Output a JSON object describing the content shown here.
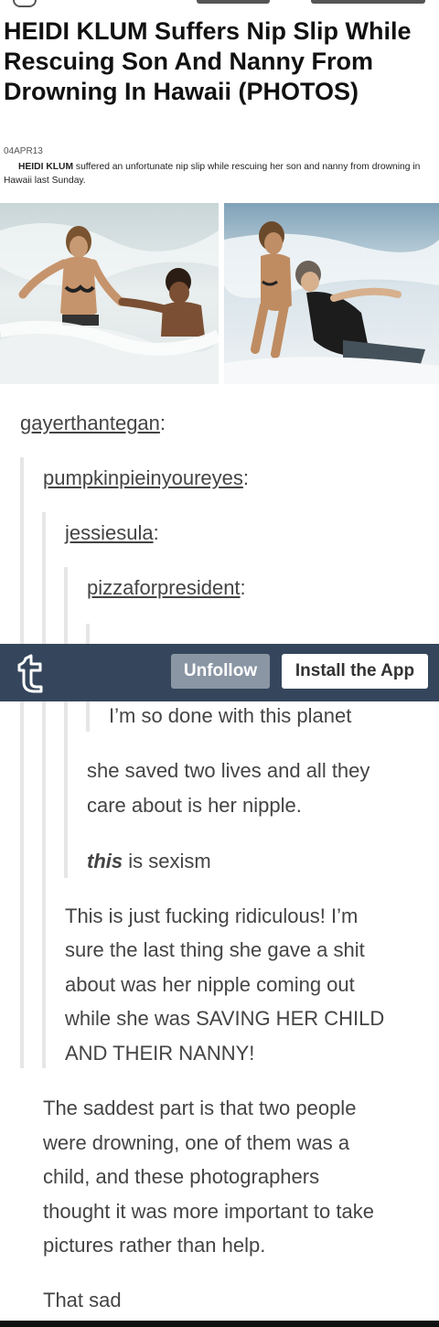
{
  "article": {
    "headline": "HEIDI KLUM Suffers Nip Slip While Rescuing Son And Nanny From Drowning In Hawaii (PHOTOS)",
    "date": "04APR13",
    "summary_bold": "HEIDI KLUM",
    "summary_rest": " suffered an unfortunate nip slip while rescuing her son and nanny from drowning in Hawaii last Sunday."
  },
  "reblog_chain": [
    {
      "username": "gayerthantegan",
      "colon": ":"
    },
    {
      "username": "pumpkinpieinyoureyes",
      "colon": ":"
    },
    {
      "username": "jessiesula",
      "colon": ":"
    },
    {
      "username": "pizzaforpresident",
      "colon": ":"
    }
  ],
  "tumblr_bar": {
    "logo": "t",
    "unfollow_label": "Unfollow",
    "install_label": "Install the App"
  },
  "comments": {
    "c1": "I’m so done with this planet",
    "c2_line1": "she saved two lives and all they",
    "c2_line2": "care about is her nipple.",
    "c3_em": "this",
    "c3_rest": " is sexism",
    "c4_line1": "This is just fucking ridiculous! I’m",
    "c4_line2": "sure the last thing she gave a shit",
    "c4_line3": "about was her nipple coming out",
    "c4_line4": "while she was SAVING HER CHILD",
    "c4_line5": "AND THEIR NANNY!",
    "c5_line1": "The saddest part is that two people",
    "c5_line2": "were drowning, one of them was a",
    "c5_line3": "child, and these photographers",
    "c5_line4": "thought it was more important to take",
    "c5_line5": "pictures rather than help.",
    "c6": "That sad"
  },
  "colors": {
    "tumblr_navy": "#35465c",
    "unfollow_gray": "#8a96a4",
    "text": "#444444"
  }
}
